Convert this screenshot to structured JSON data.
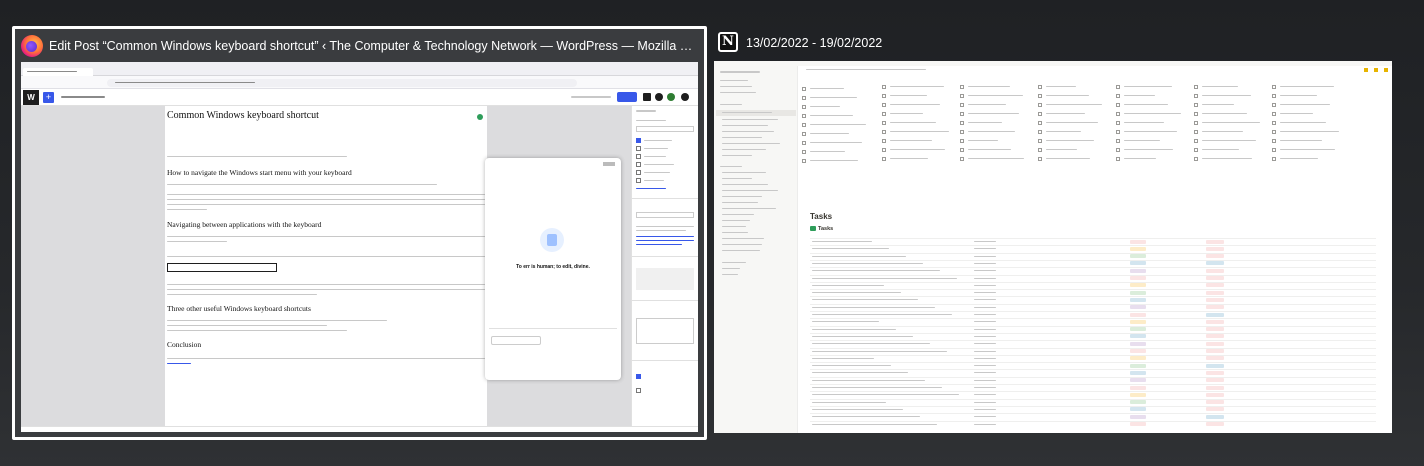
{
  "windows": [
    {
      "title": "Edit Post “Common Windows keyboard shortcut” ‹ The Computer & Technology Network — WordPress — Mozilla Fi...",
      "app_icon": "firefox-icon",
      "selected": true,
      "content": {
        "post_title": "Common Windows keyboard shortcut",
        "headings": [
          "How to navigate the Windows start menu with your keyboard",
          "Navigating between applications with the keyboard",
          "Three other useful Windows keyboard shortcuts",
          "Conclusion"
        ],
        "modal_text": "To err is human; to edit, divine."
      }
    },
    {
      "title": "13/02/2022 - 19/02/2022",
      "app_icon": "notion-icon",
      "selected": false,
      "content": {
        "section_title": "Tasks",
        "table_title": "Tasks"
      }
    }
  ],
  "colors": {
    "background": "#26282b",
    "selected_border": "#ffffff",
    "wp_blue": "#3858e9",
    "notion_sidebar": "#f7f7f5"
  }
}
